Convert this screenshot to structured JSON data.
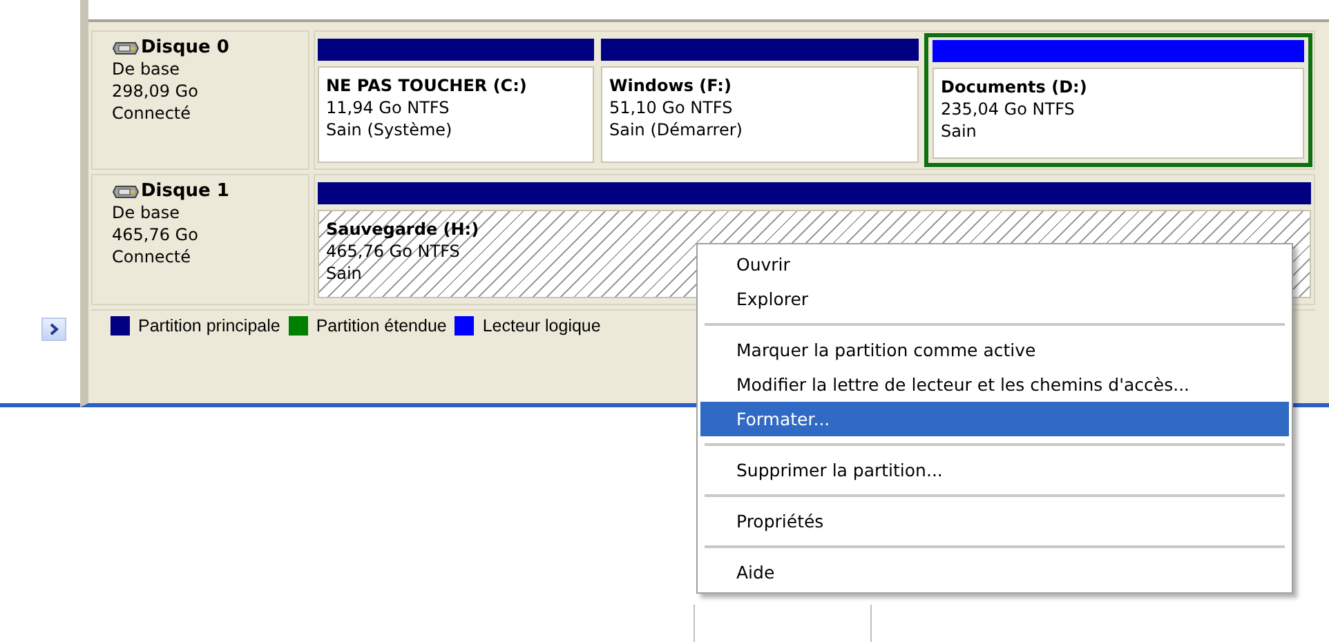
{
  "disks": [
    {
      "name": "Disque 0",
      "type": "De base",
      "size": "298,09 Go",
      "status": "Connecté",
      "partitions": [
        {
          "kind": "primary",
          "name": "NE PAS TOUCHER  (C:)",
          "size": "11,94 Go NTFS",
          "status": "Sain (Système)",
          "selected": false
        },
        {
          "kind": "primary",
          "name": "Windows  (F:)",
          "size": "51,10 Go NTFS",
          "status": "Sain (Démarrer)",
          "selected": false
        },
        {
          "kind": "logical",
          "name": "Documents  (D:)",
          "size": "235,04 Go NTFS",
          "status": "Sain",
          "selected": false
        }
      ]
    },
    {
      "name": "Disque 1",
      "type": "De base",
      "size": "465,76 Go",
      "status": "Connecté",
      "partitions": [
        {
          "kind": "primary",
          "name": "Sauvegarde  (H:)",
          "size": "465,76 Go NTFS",
          "status": "Sain",
          "selected": true
        }
      ]
    }
  ],
  "legend": [
    {
      "label": "Partition principale",
      "color": "#000080"
    },
    {
      "label": "Partition étendue",
      "color": "#008000"
    },
    {
      "label": "Lecteur logique",
      "color": "#0000ff"
    }
  ],
  "context_menu": {
    "groups": [
      [
        {
          "label": "Ouvrir",
          "selected": false
        },
        {
          "label": "Explorer",
          "selected": false
        }
      ],
      [
        {
          "label": "Marquer la partition comme active",
          "selected": false
        },
        {
          "label": "Modifier la lettre de lecteur et les chemins d'accès...",
          "selected": false
        },
        {
          "label": "Formater...",
          "selected": true
        }
      ],
      [
        {
          "label": "Supprimer la partition...",
          "selected": false
        }
      ],
      [
        {
          "label": "Propriétés",
          "selected": false
        }
      ],
      [
        {
          "label": "Aide",
          "selected": false
        }
      ]
    ]
  }
}
